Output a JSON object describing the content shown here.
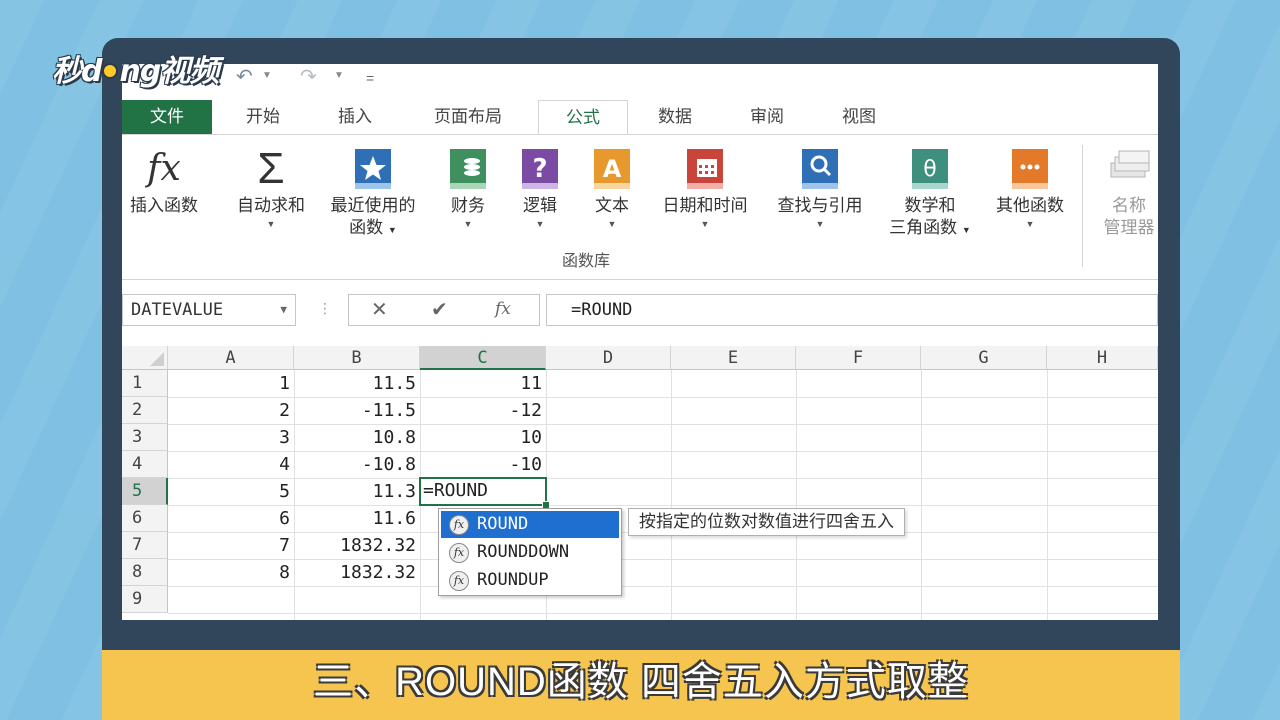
{
  "brand": {
    "logo_left": "秒d",
    "logo_right": "ng视频"
  },
  "quick_access": {
    "undo": "↶",
    "redo": "↷",
    "customize": "="
  },
  "tabs": [
    {
      "label": "文件"
    },
    {
      "label": "开始"
    },
    {
      "label": "插入"
    },
    {
      "label": "页面布局"
    },
    {
      "label": "公式"
    },
    {
      "label": "数据"
    },
    {
      "label": "审阅"
    },
    {
      "label": "视图"
    }
  ],
  "ribbon": {
    "insert_function": {
      "label": "插入函数",
      "glyph": "fx"
    },
    "autosum": {
      "label": "自动求和",
      "glyph": "Σ"
    },
    "recent": {
      "label1": "最近使用的",
      "label2": "函数"
    },
    "financial": {
      "label": "财务"
    },
    "logical": {
      "label": "逻辑",
      "glyph": "?"
    },
    "text": {
      "label": "文本",
      "glyph": "A"
    },
    "datetime": {
      "label": "日期和时间"
    },
    "lookup": {
      "label": "查找与引用"
    },
    "math": {
      "label1": "数学和",
      "label2": "三角函数",
      "glyph": "θ"
    },
    "more": {
      "label": "其他函数",
      "glyph": "···"
    },
    "name_manager": {
      "label1": "名称",
      "label2": "管理器"
    },
    "group_label": "函数库",
    "dropdown_arrow": "▼"
  },
  "formula_bar": {
    "name_box": "DATEVALUE",
    "cancel": "✕",
    "enter": "✔",
    "fx": "fx",
    "formula": "=ROUND"
  },
  "columns": [
    "A",
    "B",
    "C",
    "D",
    "E",
    "F",
    "G",
    "H"
  ],
  "rows": [
    "1",
    "2",
    "3",
    "4",
    "5",
    "6",
    "7",
    "8",
    "9"
  ],
  "cells": {
    "A": [
      "1",
      "2",
      "3",
      "4",
      "5",
      "6",
      "7",
      "8"
    ],
    "B": [
      "11.5",
      "-11.5",
      "10.8",
      "-10.8",
      "11.3",
      "11.6",
      "1832.32",
      "1832.32"
    ],
    "C": [
      "11",
      "-12",
      "10",
      "-10"
    ],
    "C5_edit": "=ROUND"
  },
  "autocomplete": {
    "items": [
      "ROUND",
      "ROUNDDOWN",
      "ROUNDUP"
    ],
    "tooltip": "按指定的位数对数值进行四舍五入"
  },
  "caption": "三、ROUND函数  四舍五入方式取整",
  "colors": {
    "excel_green": "#217346",
    "selection_blue": "#1f6fd0",
    "caption_bg": "#f6c54f",
    "frame": "#31465b",
    "backdrop": "#7fc0e3"
  }
}
